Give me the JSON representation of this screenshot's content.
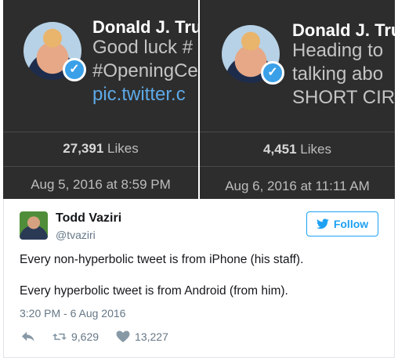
{
  "screenshots": [
    {
      "name": "Donald J. Tru",
      "lines": [
        "Good luck #",
        "#OpeningCe"
      ],
      "link": "pic.twitter.c",
      "likes_count": "27,391",
      "likes_label": "Likes",
      "date": "Aug 5, 2016 at 8:59 PM"
    },
    {
      "name": "Donald J. Tru",
      "lines": [
        "Heading to",
        "talking abo",
        "SHORT CIR"
      ],
      "likes_count": "4,451",
      "likes_label": "Likes",
      "date": "Aug 6, 2016 at 11:11 AM"
    }
  ],
  "tweet": {
    "author_name": "Todd Vaziri",
    "author_handle": "@tvaziri",
    "follow_label": "Follow",
    "text_line1": "Every non-hyperbolic tweet is from iPhone (his staff).",
    "text_line2": "Every hyperbolic tweet is from Android (from him).",
    "timestamp": "3:20 PM - 6 Aug 2016",
    "retweets": "9,629",
    "likes": "13,227"
  },
  "colors": {
    "accent": "#1da1f2",
    "dark_bg": "#2d2d2d",
    "verified": "#3aa0e8"
  }
}
